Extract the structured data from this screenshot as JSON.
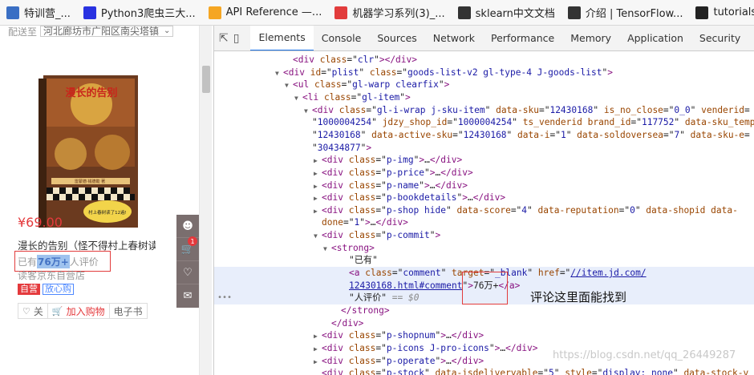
{
  "bookmarks": [
    {
      "icon": "page-icon",
      "label": "特训营_...",
      "color": "#3a6fc4"
    },
    {
      "icon": "baidu-paw-icon",
      "label": "Python3爬虫三大...",
      "color": "#2932e1"
    },
    {
      "icon": "api-chart-icon",
      "label": "API Reference —...",
      "color": "#f5a623"
    },
    {
      "icon": "csdn-c-icon",
      "label": "机器学习系列(3)_...",
      "color": "#e23c3c"
    },
    {
      "icon": "sklearn-icon",
      "label": "sklearn中文文档",
      "color": "#333333"
    },
    {
      "icon": "book-icon",
      "label": "介绍 | TensorFlow...",
      "color": "#333333"
    },
    {
      "icon": "github-icon",
      "label": "tutorials/tensorflo",
      "color": "#222222"
    }
  ],
  "left": {
    "delivery_label": "配送至",
    "delivery_address": "河北廊坊市广阳区南尖塔镇",
    "book_cover": {
      "title": "漫长的告别",
      "band": "雷蒙德·钱德勒 著",
      "subtitle": "村上春树读了12遍!"
    },
    "price": "¥69.00",
    "title": "漫长的告别（怪不得村上春树读",
    "comment_prefix": "已有",
    "comment_count": "76万+",
    "comment_suffix": "人评价",
    "shop": "读客京东自营店",
    "tag_self": "自营",
    "tag_promo": "放心购",
    "actions": {
      "follow": "关",
      "cart": "加入购物",
      "ebook": "电子书"
    },
    "cart_badge": "1"
  },
  "devtools": {
    "tabs": [
      "Elements",
      "Console",
      "Sources",
      "Network",
      "Performance",
      "Memory",
      "Application",
      "Security",
      "Au"
    ],
    "active_tab": "Elements",
    "lines": [
      {
        "indent": 100,
        "tri": "",
        "html": "<span class='t'>&lt;div</span> <span class='a'>class</span>=\"<span class='v'>clr</span>\"<span class='t'>&gt;&lt;/div&gt;</span>"
      },
      {
        "indent": 88,
        "tri": "▼",
        "html": "<span class='t'>&lt;div</span> <span class='a'>id</span>=\"<span class='v'>plist</span>\" <span class='a'>class</span>=\"<span class='v'>goods-list-v2 gl-type-4 J-goods-list</span>\"<span class='t'>&gt;</span>"
      },
      {
        "indent": 100,
        "tri": "▼",
        "html": "<span class='t'>&lt;ul</span> <span class='a'>class</span>=\"<span class='v'>gl-warp clearfix</span>\"<span class='t'>&gt;</span>"
      },
      {
        "indent": 112,
        "tri": "▼",
        "html": "<span class='t'>&lt;li</span> <span class='a'>class</span>=\"<span class='v'>gl-item</span>\"<span class='t'>&gt;</span>"
      },
      {
        "indent": 124,
        "tri": "▼",
        "html": "<span class='t'>&lt;div</span> <span class='a'>class</span>=\"<span class='v'>gl-i-wrap j-sku-item</span>\" <span class='a'>data-sku</span>=\"<span class='v'>12430168</span>\" <span class='a'>is_no_close</span>=\"<span class='v'>0_0</span>\" <span class='a'>venderid</span>="
      },
      {
        "indent": 124,
        "tri": "",
        "html": "\"<span class='v'>1000004254</span>\" <span class='a'>jdzy_shop_id</span>=\"<span class='v'>1000004254</span>\" <span class='a'>ts_venderid</span> <span class='a'>brand_id</span>=\"<span class='v'>117752</span>\" <span class='a'>data-sku_temp</span>="
      },
      {
        "indent": 124,
        "tri": "",
        "html": "\"<span class='v'>12430168</span>\" <span class='a'>data-active-sku</span>=\"<span class='v'>12430168</span>\" <span class='a'>data-i</span>=\"<span class='v'>1</span>\" <span class='a'>data-soldoversea</span>=\"<span class='v'>7</span>\" <span class='a'>data-sku-e</span>="
      },
      {
        "indent": 124,
        "tri": "",
        "html": "\"<span class='v'>30434877</span>\"<span class='t'>&gt;</span>"
      },
      {
        "indent": 136,
        "tri": "▶",
        "html": "<span class='t'>&lt;div</span> <span class='a'>class</span>=\"<span class='v'>p-img</span>\"<span class='t'>&gt;</span>…<span class='t'>&lt;/div&gt;</span>"
      },
      {
        "indent": 136,
        "tri": "▶",
        "html": "<span class='t'>&lt;div</span> <span class='a'>class</span>=\"<span class='v'>p-price</span>\"<span class='t'>&gt;</span>…<span class='t'>&lt;/div&gt;</span>"
      },
      {
        "indent": 136,
        "tri": "▶",
        "html": "<span class='t'>&lt;div</span> <span class='a'>class</span>=\"<span class='v'>p-name</span>\"<span class='t'>&gt;</span>…<span class='t'>&lt;/div&gt;</span>"
      },
      {
        "indent": 136,
        "tri": "▶",
        "html": "<span class='t'>&lt;div</span> <span class='a'>class</span>=\"<span class='v'>p-bookdetails</span>\"<span class='t'>&gt;</span>…<span class='t'>&lt;/div&gt;</span>"
      },
      {
        "indent": 136,
        "tri": "▶",
        "html": "<span class='t'>&lt;div</span> <span class='a'>class</span>=\"<span class='v'>p-shop hide</span>\" <span class='a'>data-score</span>=\"<span class='v'>4</span>\" <span class='a'>data-reputation</span>=\"<span class='v'>0</span>\" <span class='a'>data-shopid</span> <span class='a'>data-</span>"
      },
      {
        "indent": 136,
        "tri": "",
        "html": "<span class='a'>done</span>=\"<span class='v'>1</span>\"<span class='t'>&gt;</span>…<span class='t'>&lt;/div&gt;</span>"
      },
      {
        "indent": 136,
        "tri": "▼",
        "html": "<span class='t'>&lt;div</span> <span class='a'>class</span>=\"<span class='v'>p-commit</span>\"<span class='t'>&gt;</span>"
      },
      {
        "indent": 148,
        "tri": "▼",
        "html": "<span class='t'>&lt;strong&gt;</span>"
      },
      {
        "indent": 170,
        "tri": "",
        "html": "<span class='s'>\"已有\"</span>"
      },
      {
        "indent": 170,
        "tri": "",
        "hl": true,
        "html": "<span class='t'>&lt;a</span> <span class='a'>class</span>=\"<span class='v'>comment</span>\" <span class='a'>target</span>=\"<span class='v'>_blank</span>\" <span class='a'>href</span>=\"<span class='lnk'>//item.jd.com/</span>"
      },
      {
        "indent": 170,
        "tri": "",
        "hl": true,
        "html": "<span class='lnk'>12430168.html#comment</span>\"<span class='t'>&gt;</span><span class='s'>76万+</span><span class='t'>&lt;/a&gt;</span>"
      },
      {
        "indent": 170,
        "tri": "",
        "hl": true,
        "html": "<span class='s'>\"人评价\"</span> <span class='g'>== $0</span>"
      },
      {
        "indent": 160,
        "tri": "",
        "html": "<span class='t'>&lt;/strong&gt;</span>"
      },
      {
        "indent": 148,
        "tri": "",
        "html": "<span class='t'>&lt;/div&gt;</span>"
      },
      {
        "indent": 136,
        "tri": "▶",
        "html": "<span class='t'>&lt;div</span> <span class='a'>class</span>=\"<span class='v'>p-shopnum</span>\"<span class='t'>&gt;</span>…<span class='t'>&lt;/div&gt;</span>"
      },
      {
        "indent": 136,
        "tri": "▶",
        "html": "<span class='t'>&lt;div</span> <span class='a'>class</span>=\"<span class='v'>p-icons J-pro-icons</span>\"<span class='t'>&gt;</span>…<span class='t'>&lt;/div&gt;</span>"
      },
      {
        "indent": 136,
        "tri": "▶",
        "html": "<span class='t'>&lt;div</span> <span class='a'>class</span>=\"<span class='v'>p-operate</span>\"<span class='t'>&gt;</span>…<span class='t'>&lt;/div&gt;</span>"
      },
      {
        "indent": 136,
        "tri": "",
        "html": "<span class='t'>&lt;div</span> <span class='a'>class</span>=\"<span class='v'>p-stock</span>\" <span class='a'>data-isdeliveryable</span>=\"<span class='v'>5</span>\" <span class='a'>style</span>=\"<span class='v'>display: none</span>\" <span class='a'>data-stock-v</span>"
      }
    ],
    "ellipsis": "•••",
    "annotation": "评论这里面能找到",
    "watermark": "https://blog.csdn.net/qq_26449287"
  }
}
